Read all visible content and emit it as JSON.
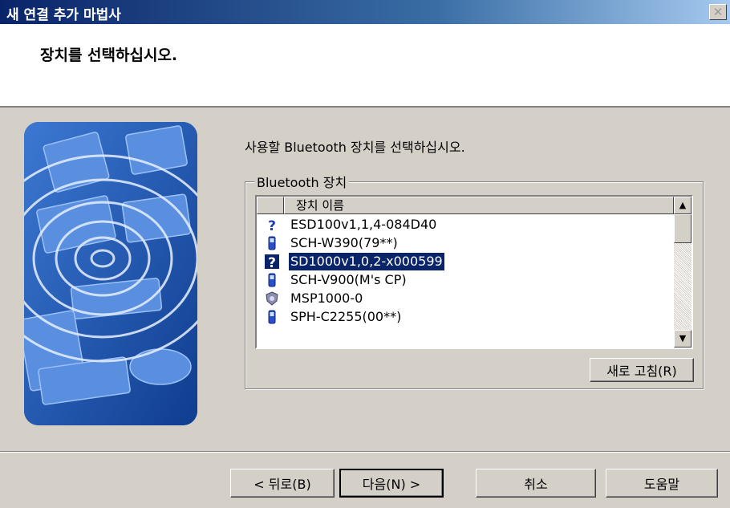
{
  "window": {
    "title": "새 연결 추가 마법사",
    "close_glyph": "✕"
  },
  "header": {
    "heading": "장치를 선택하십시오."
  },
  "main": {
    "instruction": "사용할 Bluetooth 장치를 선택하십시오.",
    "group_label": "Bluetooth 장치",
    "list": {
      "column_header": "장치 이름",
      "rows": [
        {
          "name": "ESD100v1,1,4-084D40",
          "icon": "unknown-device-icon",
          "selected": false
        },
        {
          "name": "SCH-W390(79**)",
          "icon": "phone-icon",
          "selected": false
        },
        {
          "name": "SD1000v1,0,2-x000599",
          "icon": "unknown-device-icon",
          "selected": true
        },
        {
          "name": "SCH-V900(M's CP)",
          "icon": "phone-icon",
          "selected": false
        },
        {
          "name": "MSP1000-0",
          "icon": "shield-device-icon",
          "selected": false
        },
        {
          "name": "SPH-C2255(00**)",
          "icon": "phone-icon",
          "selected": false
        }
      ]
    },
    "refresh_button": "새로 고침(R)"
  },
  "footer": {
    "back_button": "< 뒤로(B)",
    "next_button": "다음(N) >",
    "cancel_button": "취소",
    "help_button": "도움말"
  },
  "colors": {
    "title_bar": "#0a246a",
    "selection": "#0a246a",
    "art_blue": "#1a4fa8",
    "face": "#d4d0c8"
  }
}
